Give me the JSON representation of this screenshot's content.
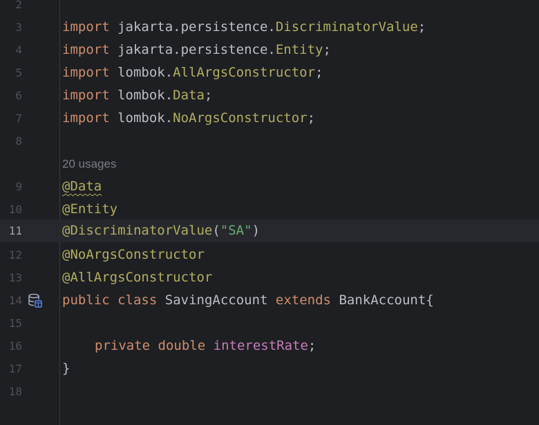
{
  "editor": {
    "current_line": "11",
    "usages_hint": "20 usages",
    "lines": [
      {
        "num": "2"
      },
      {
        "num": "3",
        "kw": "import",
        "pkg": " jakarta.persistence.",
        "name": "DiscriminatorValue",
        "end": ";"
      },
      {
        "num": "4",
        "kw": "import",
        "pkg": " jakarta.persistence.",
        "name": "Entity",
        "end": ";"
      },
      {
        "num": "5",
        "kw": "import",
        "pkg": " lombok.",
        "name": "AllArgsConstructor",
        "end": ";"
      },
      {
        "num": "6",
        "kw": "import",
        "pkg": " lombok.",
        "name": "Data",
        "end": ";"
      },
      {
        "num": "7",
        "kw": "import",
        "pkg": " lombok.",
        "name": "NoArgsConstructor",
        "end": ";"
      },
      {
        "num": "8"
      },
      {
        "num": "9",
        "annotation": "@Data"
      },
      {
        "num": "10",
        "annotation": "@Entity"
      },
      {
        "num": "11",
        "annotation": "@DiscriminatorValue",
        "paren_open": "(",
        "string": "\"SA\"",
        "paren_close": ")"
      },
      {
        "num": "12",
        "annotation": "@NoArgsConstructor"
      },
      {
        "num": "13",
        "annotation": "@AllArgsConstructor"
      },
      {
        "num": "14",
        "kw1": "public",
        "kw2": "class",
        "classname": "SavingAccount",
        "kw3": "extends",
        "parent": "BankAccount",
        "brace": "{"
      },
      {
        "num": "15"
      },
      {
        "num": "16",
        "kw1": "private",
        "kw2": "double",
        "field": "interestRate",
        "end": ";"
      },
      {
        "num": "17",
        "brace": "}"
      },
      {
        "num": "18"
      }
    ],
    "gutter_icon": "database-entity-icon"
  },
  "colors": {
    "background": "#1e1f22",
    "keyword": "#cf8e6d",
    "annotation": "#b3ae60",
    "string": "#6aab73",
    "field": "#c77dbb",
    "text": "#bcbec4",
    "line_number": "#4e5157",
    "current_line_bg": "#26282e"
  }
}
